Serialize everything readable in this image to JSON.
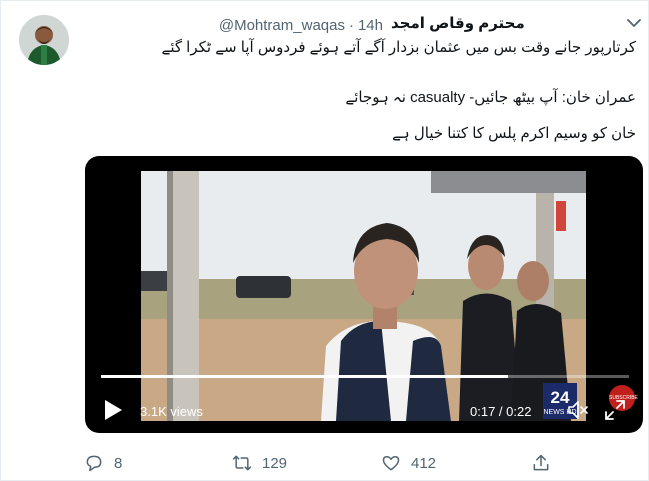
{
  "tweet": {
    "author_name": "محترم وقاص امجد",
    "handle": "@Mohtram_waqas",
    "separator": "·",
    "time": "14h",
    "lines": [
      "کرتارپور جانے وقت بس میں عثمان بزدار آگے آتے ہوئے فردوس آپا سے ٹکرا گئے",
      "",
      "عمران خان: آپ بیٹھ جائیں- casualty نہ ہوجائے",
      "خان کو وسیم اکرم پلس کا کتنا خیال ہے"
    ]
  },
  "video": {
    "views": "3.1K views",
    "time": "0:17 / 0:22",
    "progress_fraction": 0.77,
    "channel_logo": "24 NEWS HD",
    "subscribe_text": "SUBSCRIBE"
  },
  "actions": {
    "reply_count": "8",
    "retweet_count": "129",
    "like_count": "412"
  },
  "icons": {
    "avatar": "user-avatar",
    "caret": "chevron-down-icon",
    "play": "play-icon",
    "volume": "volume-icon",
    "expand": "expand-icon",
    "reply": "reply-icon",
    "retweet": "retweet-icon",
    "like": "heart-icon",
    "share": "share-icon"
  }
}
